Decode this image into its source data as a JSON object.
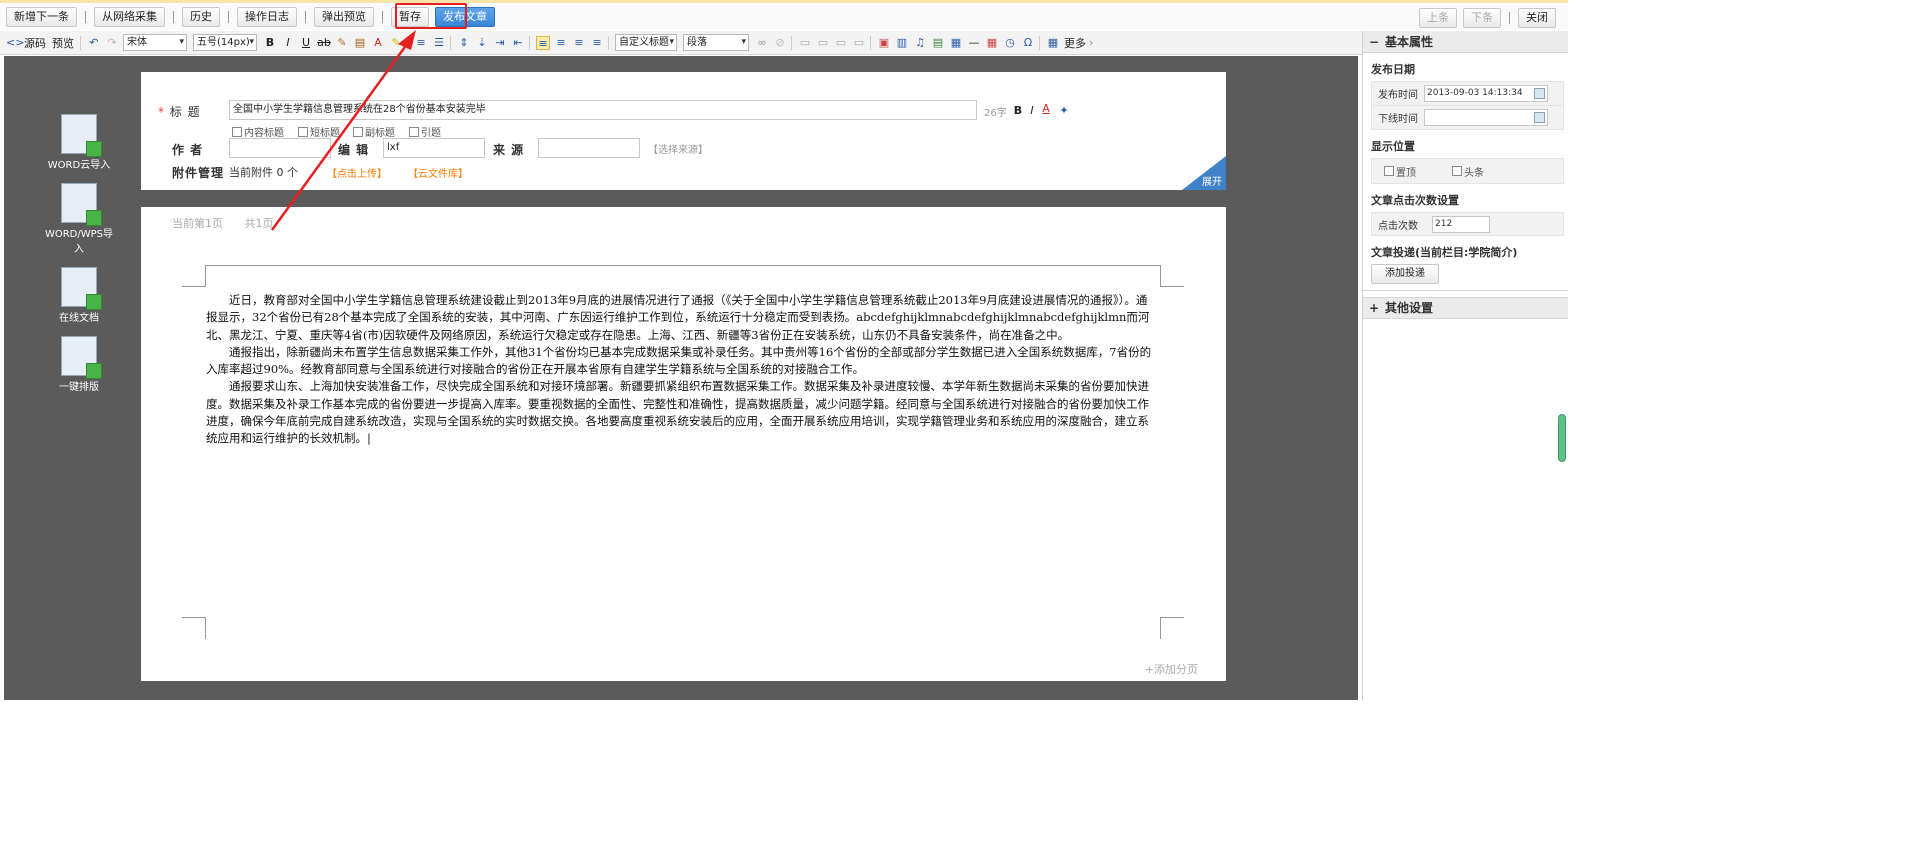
{
  "topbar": {
    "buttons": [
      "新增下一条",
      "从网络采集",
      "历史",
      "操作日志",
      "弹出预览",
      "暂存",
      "发布文章"
    ],
    "right_buttons": [
      "上条",
      "下条",
      "关闭"
    ]
  },
  "toolbar": {
    "source": "源码",
    "preview": "预览",
    "font_family": "宋体",
    "font_size": "五号(14px)",
    "custom_title": "自定义标题",
    "paragraph": "段落",
    "more": "更多"
  },
  "left_imports": [
    {
      "label": "WORD云导入",
      "icon": "cloud-import-icon"
    },
    {
      "label": "WORD/WPS导入",
      "icon": "word-import-icon"
    },
    {
      "label": "在线文档",
      "icon": "online-doc-icon"
    },
    {
      "label": "一键排版",
      "icon": "auto-layout-icon"
    }
  ],
  "form": {
    "title_label": "标  题",
    "title_value": "全国中小学生学籍信息管理系统在28个省份基本安装完毕",
    "char_count": "26字",
    "checkboxes": [
      "内容标题",
      "短标题",
      "副标题",
      "引题"
    ],
    "author_label": "作  者",
    "author_value": "",
    "editor_label": "编  辑",
    "editor_value": "lxf",
    "source_label": "来  源",
    "source_value": "",
    "choose_source": "【选择来源】",
    "attach_label": "附件管理",
    "attach_count": "当前附件 0 个",
    "upload": "【点击上传】",
    "cloud_lib": "【云文件库】",
    "expand": "展开"
  },
  "editor": {
    "current_page": "当前第1页",
    "total_pages": "共1页",
    "paragraphs": [
      "近日，教育部对全国中小学生学籍信息管理系统建设截止到2013年9月底的进展情况进行了通报（《关于全国中小学生学籍信息管理系统截止2013年9月底建设进展情况的通报》）。通报显示，32个省份已有28个基本完成了全国系统的安装，其中河南、广东因运行维护工作到位，系统运行十分稳定而受到表扬。abcdefghijklmnabcdefghijklmnabcdefghijklmn而河北、黑龙江、宁夏、重庆等4省(市)因软硬件及网络原因，系统运行欠稳定或存在隐患。上海、江西、新疆等3省份正在安装系统，山东仍不具备安装条件，尚在准备之中。",
      "通报指出，除新疆尚未布置学生信息数据采集工作外，其他31个省份均已基本完成数据采集或补录任务。其中贵州等16个省份的全部或部分学生数据已进入全国系统数据库，7省份的入库率超过90%。经教育部同意与全国系统进行对接融合的省份正在开展本省原有自建学生学籍系统与全国系统的对接融合工作。",
      "通报要求山东、上海加快安装准备工作，尽快完成全国系统和对接环境部署。新疆要抓紧组织布置数据采集工作。数据采集及补录进度较慢、本学年新生数据尚未采集的省份要加快进度。数据采集及补录工作基本完成的省份要进一步提高入库率。要重视数据的全面性、完整性和准确性，提高数据质量，减少问题学籍。经同意与全国系统进行对接融合的省份要加快工作进度，确保今年底前完成自建系统改造，实现与全国系统的实时数据交换。各地要高度重视系统安装后的应用，全面开展系统应用培训，实现学籍管理业务和系统应用的深度融合，建立系统应用和运行维护的长效机制。|"
    ],
    "add_page": "+添加分页"
  },
  "sidebar": {
    "basic_header": "基本属性",
    "publish_date_title": "发布日期",
    "publish_time_label": "发布时间",
    "publish_time_value": "2013-09-03 14:13:34",
    "offline_time_label": "下线时间",
    "offline_time_value": "",
    "display_pos_title": "显示位置",
    "pin_top": "置顶",
    "headline": "头条",
    "clicks_title": "文章点击次数设置",
    "clicks_label": "点击次数",
    "clicks_value": "212",
    "deliver_title": "文章投递(当前栏目:学院简介)",
    "add_deliver": "添加投递",
    "other_header": "其他设置"
  }
}
